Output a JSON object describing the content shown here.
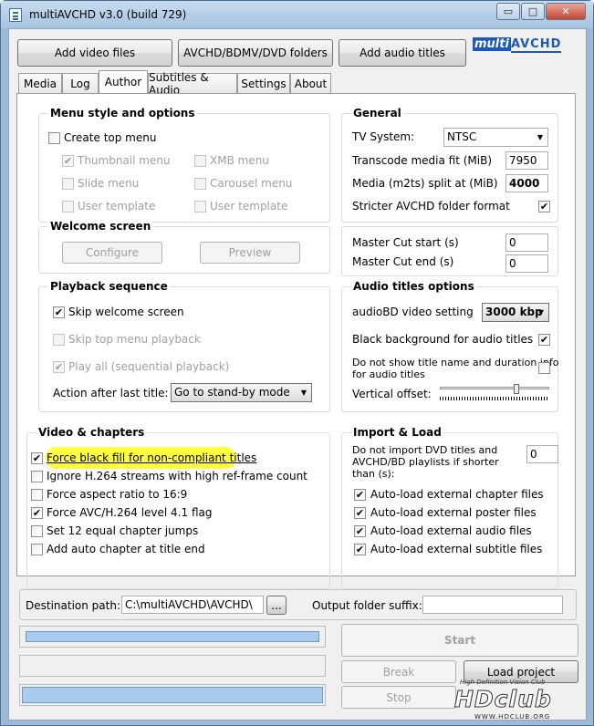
{
  "window": {
    "title": "multiAVCHD v3.0 (build 729)",
    "minimize": "▭",
    "maximize": "□",
    "close": "✕"
  },
  "toolbar": {
    "add_video": "Add video files",
    "avchd": "AVCHD/BDMV/DVD folders",
    "add_audio": "Add audio titles",
    "logo_multi": "multi",
    "logo_avchd": "AVCHD"
  },
  "tabs": [
    "Media",
    "Log",
    "Author",
    "Subtitles & Audio",
    "Settings",
    "About"
  ],
  "menu_style": {
    "title": "Menu style and options",
    "create_top_menu": "Create top menu",
    "thumbnail_menu": "Thumbnail menu",
    "xmb_menu": "XMB menu",
    "slide_menu": "Slide menu",
    "carousel_menu": "Carousel menu",
    "user_template_1": "User template",
    "user_template_2": "User template"
  },
  "welcome": {
    "title": "Welcome screen",
    "configure": "Configure",
    "preview": "Preview"
  },
  "playback": {
    "title": "Playback sequence",
    "skip_welcome": "Skip welcome screen",
    "skip_top": "Skip top menu playback",
    "play_all": "Play all (sequential playback)",
    "action_label": "Action after last title:",
    "action_value": "Go to stand-by mode"
  },
  "general": {
    "title": "General",
    "tv_system_label": "TV System:",
    "tv_system_value": "NTSC",
    "transcode_label": "Transcode media fit (MiB)",
    "transcode_value": "7950",
    "split_label": "Media (m2ts) split at (MiB)",
    "split_value": "4000",
    "stricter_label": "Stricter AVCHD folder format"
  },
  "cut": {
    "start_label": "Master Cut start (s)",
    "start_value": "0",
    "end_label": "Master Cut end (s)",
    "end_value": "0"
  },
  "audio_titles": {
    "title": "Audio titles options",
    "audiobd_label": "audioBD video setting",
    "audiobd_value": "3000 kbp",
    "black_bg_label": "Black background for audio titles",
    "no_show_label_1": "Do not show title name and duration info",
    "no_show_label_2": "for audio titles",
    "vertical_label": "Vertical offset:"
  },
  "video_chapters": {
    "title": "Video & chapters",
    "force_black": "Force black fill for non-compliant titles",
    "ignore_h264": "Ignore H.264 streams with high ref-frame count",
    "force_aspect": "Force aspect ratio to 16:9",
    "force_avc": "Force AVC/H.264 level 4.1 flag",
    "set_12": "Set 12 equal chapter jumps",
    "add_auto": "Add auto chapter at title end"
  },
  "import_load": {
    "title": "Import & Load",
    "no_import_1": "Do not import DVD titles and",
    "no_import_2": "AVCHD/BD playlists if shorter",
    "no_import_3": "than (s):",
    "no_import_value": "0",
    "chapter_files": "Auto-load external chapter files",
    "poster_files": "Auto-load external poster files",
    "audio_files": "Auto-load external audio files",
    "subtitle_files": "Auto-load external subtitle files"
  },
  "destination": {
    "label": "Destination path:",
    "value": "C:\\multiAVCHD\\AVCHD\\",
    "browse": "...",
    "suffix_label": "Output folder suffix:",
    "suffix_value": ""
  },
  "actions": {
    "start": "Start",
    "break": "Break",
    "load_project": "Load project",
    "stop": "Stop"
  },
  "watermark": {
    "main": "HDclub",
    "tagline": "High Definition Vision Club",
    "url": "WWW.HDCLUB.ORG"
  },
  "colors": {
    "highlight": "#ffff40",
    "progress": "#a9ccee"
  },
  "progress": {
    "bar1": 1.0,
    "bar2": 0.0,
    "bar3": 1.0
  }
}
